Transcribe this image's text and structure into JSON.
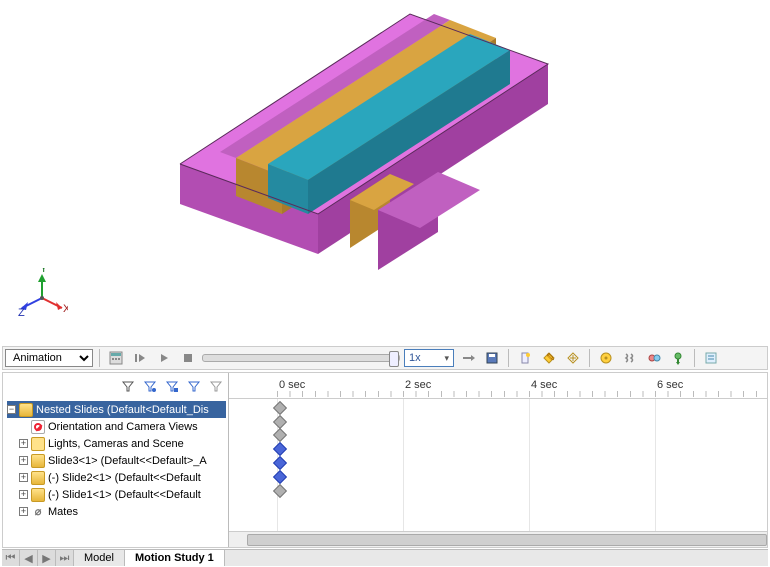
{
  "triad": {
    "x": "X",
    "y": "Y",
    "z": "Z"
  },
  "animation": {
    "mode": "Animation",
    "speed": "1x"
  },
  "ruler": {
    "t0": "0 sec",
    "t2": "2 sec",
    "t4": "4 sec",
    "t6": "6 sec"
  },
  "tree": {
    "root": "Nested Slides  (Default<Default_Dis",
    "orient": "Orientation and Camera Views",
    "lights": "Lights, Cameras and Scene",
    "slide3": "Slide3<1> (Default<<Default>_A",
    "slide2": "(-) Slide2<1> (Default<<Default",
    "slide1": "(-) Slide1<1> (Default<<Default",
    "mates": "Mates"
  },
  "tabs": {
    "model": "Model",
    "ms1": "Motion Study 1"
  },
  "icons": {
    "calc": "calc",
    "play_start": "play_start",
    "play": "play",
    "stop": "stop",
    "arrow_r": "arrow_r",
    "save": "save",
    "wizard": "wizard",
    "wand": "wand",
    "gear": "gear",
    "spring": "spring",
    "contact": "contact",
    "gravity": "gravity",
    "opts": "opts",
    "filter": "filter"
  }
}
